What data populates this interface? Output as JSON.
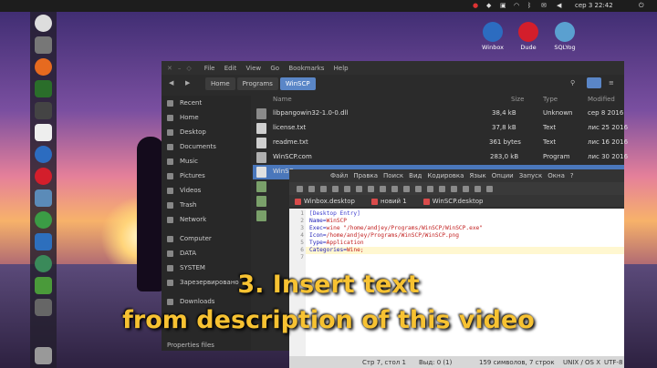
{
  "topbar": {
    "clock": "сер 3 22:42"
  },
  "desktop_icons": [
    {
      "label": "Winbox",
      "icon": "winbox-icon",
      "color": "#2c6cc0"
    },
    {
      "label": "Dude",
      "icon": "dude-icon",
      "color": "#d31e2b"
    },
    {
      "label": "SQLYog",
      "icon": "sqlyog-icon",
      "color": "#5aa0d0"
    }
  ],
  "file_manager": {
    "menu": [
      "File",
      "Edit",
      "View",
      "Go",
      "Bookmarks",
      "Help"
    ],
    "breadcrumbs": [
      "Home",
      "Programs",
      "WinSCP"
    ],
    "sidebar": [
      "Recent",
      "Home",
      "Desktop",
      "Documents",
      "Music",
      "Pictures",
      "Videos",
      "Trash",
      "Network",
      "Computer",
      "DATA",
      "SYSTEM",
      "Зарезервировано",
      "Downloads"
    ],
    "columns": {
      "name": "Name",
      "size": "Size",
      "type": "Type",
      "modified": "Modified"
    },
    "rows": [
      {
        "name": "libpangowin32-1.0-0.dll",
        "size": "38,4 kB",
        "type": "Unknown",
        "modified": "сер 8 2016"
      },
      {
        "name": "license.txt",
        "size": "37,8 kB",
        "type": "Text",
        "modified": "лис 25 2016"
      },
      {
        "name": "readme.txt",
        "size": "361 bytes",
        "type": "Text",
        "modified": "лис 16 2016"
      },
      {
        "name": "WinSCP.com",
        "size": "283,0 kB",
        "type": "Program",
        "modified": "лис 30 2016"
      },
      {
        "name": "WinSC",
        "size": "",
        "type": "",
        "modified": ""
      },
      {
        "name": "",
        "size": "",
        "type": "",
        "modified": ""
      },
      {
        "name": "",
        "size": "",
        "type": "",
        "modified": ""
      },
      {
        "name": "",
        "size": "",
        "type": "",
        "modified": ""
      }
    ],
    "status": "Properties files"
  },
  "editor": {
    "menu": [
      "Файл",
      "Правка",
      "Поиск",
      "Вид",
      "Кодировка",
      "Язык",
      "Опции",
      "Запуск",
      "Окна",
      "?"
    ],
    "tabs": [
      "Winbox.desktop",
      "новий 1",
      "WinSCP.desktop"
    ],
    "lines": [
      {
        "num": "1",
        "key": "[Desktop Entry]",
        "val": ""
      },
      {
        "num": "2",
        "key": "Name=",
        "val": "WinSCP"
      },
      {
        "num": "3",
        "key": "Exec=",
        "val": "wine \"/home/andjey/Programs/WinSCP/WinSCP.exe\""
      },
      {
        "num": "4",
        "key": "Icon=",
        "val": "/home/andjey/Programs/WinSCP/WinSCP.png"
      },
      {
        "num": "5",
        "key": "Type=",
        "val": "Application"
      },
      {
        "num": "6",
        "key": "Categories=",
        "val": "Wine;"
      },
      {
        "num": "7",
        "key": "",
        "val": ""
      }
    ],
    "status": {
      "pos": "Стр 7, стол 1",
      "sel": "Выд: 0 (1)",
      "count": "159 символов, 7 строк",
      "eol": "UNIX / OS X",
      "enc": "UTF-8"
    }
  },
  "overlay": {
    "line1": "3. Insert text",
    "line2": "from description of this video"
  },
  "colors": {
    "accent": "#4a77bb",
    "overlay_text": "#f7c232"
  }
}
